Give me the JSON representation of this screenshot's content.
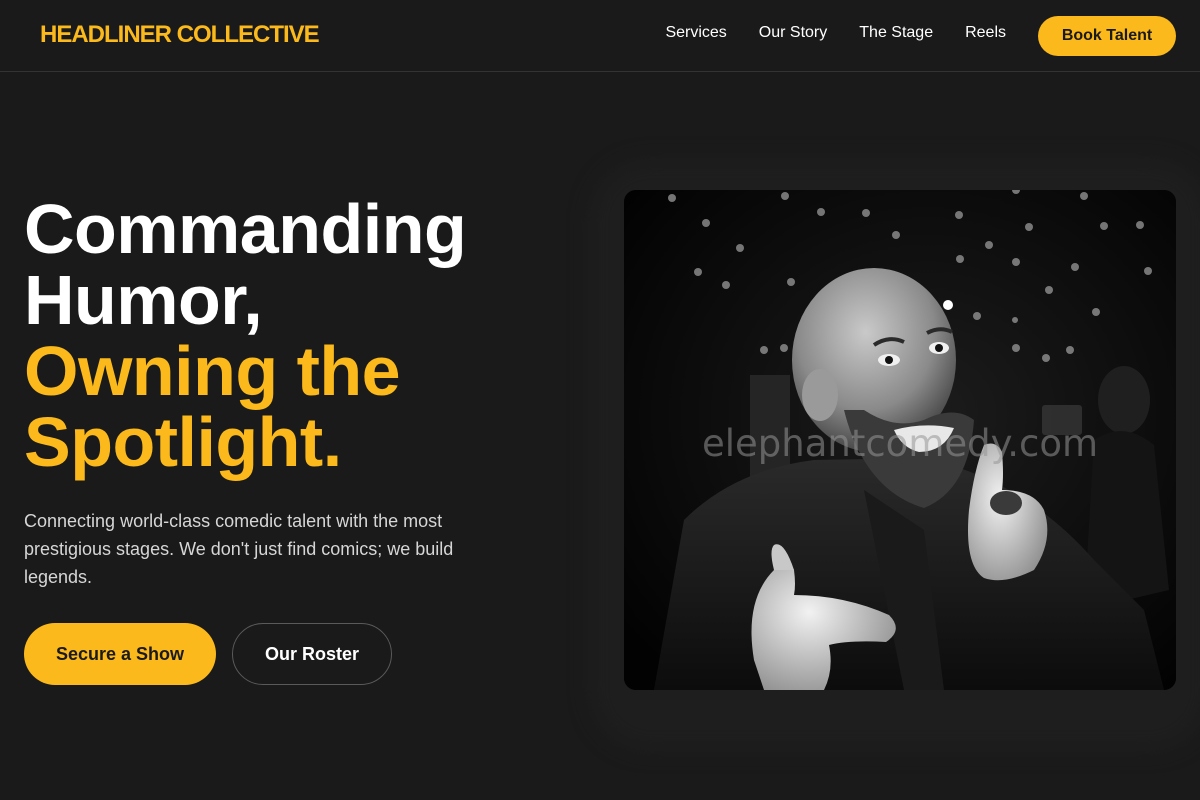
{
  "header": {
    "brand": "HEADLINER COLLECTIVE",
    "nav": [
      "Services",
      "Our Story",
      "The Stage",
      "Reels"
    ],
    "cta": "Book Talent"
  },
  "hero": {
    "title_line1": "Commanding",
    "title_line2": "Humor,",
    "title_line3": "Owning the",
    "title_line4": "Spotlight.",
    "description": "Connecting world-class comedic talent with the most prestigious stages. We don't just find comics; we build legends.",
    "primary_button": "Secure a Show",
    "secondary_button": "Our Roster"
  },
  "image": {
    "subject": "bald bearded comedian pointing at the camera with a thumbs-up, black and white",
    "watermark": "elephantcomedy.com"
  },
  "colors": {
    "background": "#1a1a1a",
    "accent": "#fbb91b",
    "text": "#ffffff",
    "muted_text": "#d6d6d6"
  }
}
